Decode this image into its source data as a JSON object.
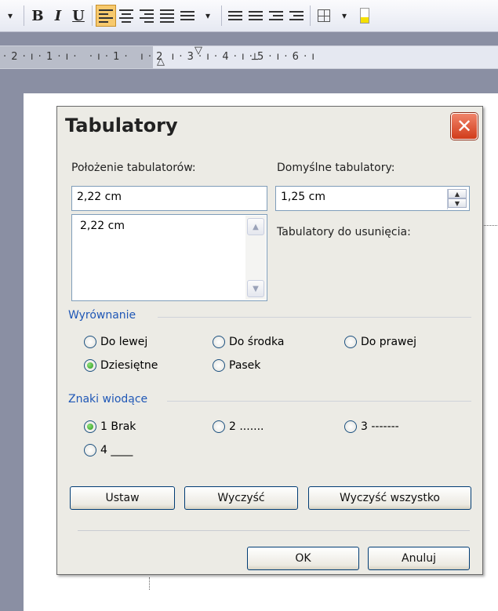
{
  "toolbar": {
    "dropdown_glyph": "▾",
    "bold": "B",
    "italic": "I",
    "underline": "U",
    "active_tool": "align-left"
  },
  "ruler": {
    "text": "· 2 · ı · 1 · ı ·   · ı · 1 ·   ı · 2  ı · 3 · ı · 4 · ı · 5 · ı · 6 · ı"
  },
  "dialog": {
    "title": "Tabulatory",
    "positions_label": "Położenie tabulatorów:",
    "positions_value": "2,22 cm",
    "positions_list": [
      "2,22 cm"
    ],
    "default_label": "Domyślne tabulatory:",
    "default_value": "1,25 cm",
    "remove_label": "Tabulatory do usunięcia:",
    "alignment": {
      "title": "Wyrównanie",
      "options": [
        {
          "label": "Do lewej",
          "checked": false
        },
        {
          "label": "Do środka",
          "checked": false
        },
        {
          "label": "Do prawej",
          "checked": false
        },
        {
          "label": "Dziesiętne",
          "checked": true
        },
        {
          "label": "Pasek",
          "checked": false
        }
      ]
    },
    "leaders": {
      "title": "Znaki wiodące",
      "options": [
        {
          "label": "1 Brak",
          "checked": true
        },
        {
          "label": "2 .......",
          "checked": false
        },
        {
          "label": "3 -------",
          "checked": false
        },
        {
          "label": "4 ____",
          "checked": false
        }
      ]
    },
    "buttons": {
      "set": "Ustaw",
      "clear": "Wyczyść",
      "clear_all": "Wyczyść wszystko",
      "ok": "OK",
      "cancel": "Anuluj"
    }
  }
}
